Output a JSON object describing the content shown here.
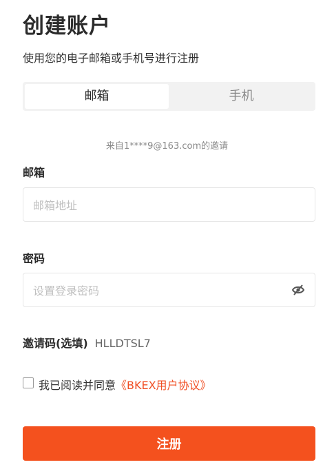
{
  "page": {
    "title": "创建账户",
    "subtitle": "使用您的电子邮箱或手机号进行注册"
  },
  "tabs": [
    {
      "label": "邮箱",
      "active": true
    },
    {
      "label": "手机",
      "active": false
    }
  ],
  "invite_note": "来自1****9@163.com的邀请",
  "email": {
    "label": "邮箱",
    "placeholder": "邮箱地址",
    "value": ""
  },
  "password": {
    "label": "密码",
    "placeholder": "设置登录密码",
    "value": "",
    "toggle_icon": "eye-off-icon"
  },
  "invite_code": {
    "label": "邀请码(选填)",
    "value": "HLLDTSL7"
  },
  "agreement": {
    "checked": false,
    "text": "我已阅读并同意",
    "link": "《BKEX用户协议》"
  },
  "submit": {
    "label": "注册"
  },
  "colors": {
    "accent": "#f4511e",
    "link": "#f04e23",
    "tab_bg": "#f2f2f2"
  }
}
